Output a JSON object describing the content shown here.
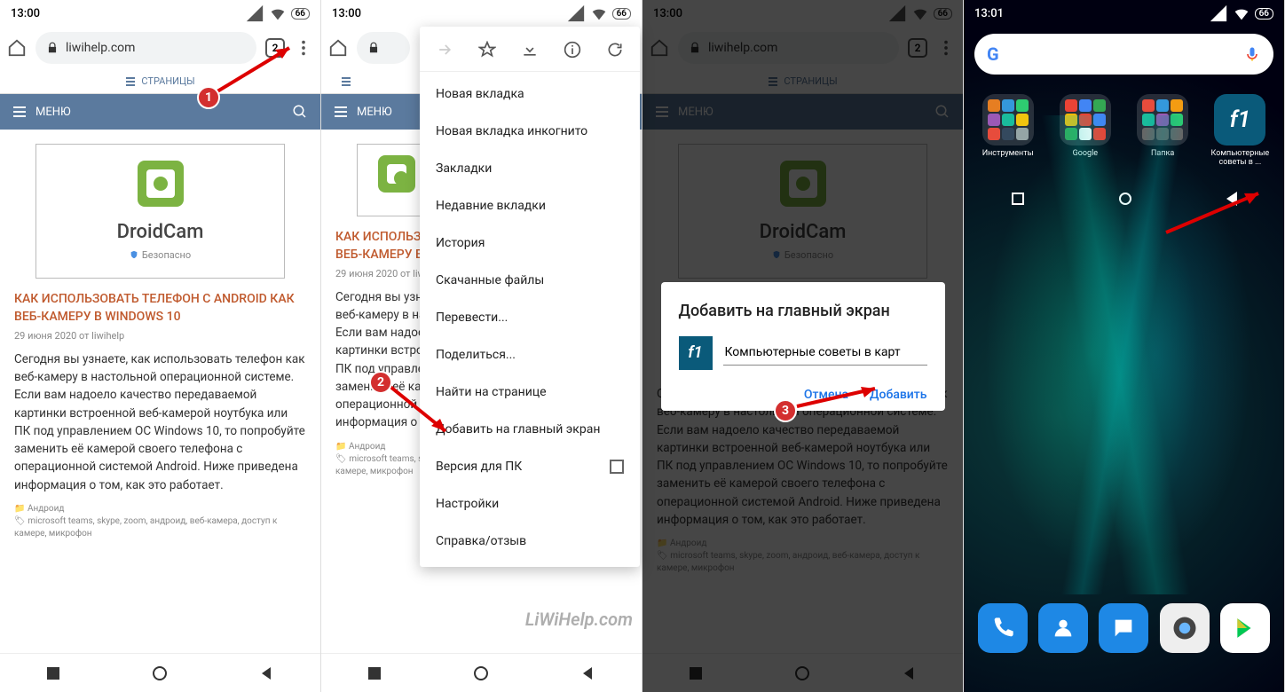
{
  "status": {
    "time1": "13:00",
    "time4": "13:01",
    "battery": "66"
  },
  "url": "liwihelp.com",
  "tabcount": "2",
  "pagesLabel": "СТРАНИЦЫ",
  "menuLabel": "МЕНЮ",
  "article": {
    "droidName": "DroidCam",
    "safe": "Безопасно",
    "title": "КАК ИСПОЛЬЗОВАТЬ ТЕЛЕФОН С ANDROID КАК ВЕБ-КАМЕРУ В WINDOWS 10",
    "titleShort": "КАК ИСПОЛЬЗОВ\nВЕБ-КАМЕРУ В",
    "meta": "29 июня 2020 от liwihelp",
    "text": "Сегодня вы узнаете, как использовать телефон как веб-камеру в настольной операционной системе. Если вам надоело качество передаваемой картинки встроенной веб-камерой ноутбука или ПК под управлением ОС Windows 10, то попробуйте заменить её камерой своего телефона с операционной системой Android. Ниже приведена информация о том, как это работает.",
    "cat": "Андроид",
    "tags": "microsoft teams, skype, zoom, андроид, веб-камера, доступ к камере, микрофон"
  },
  "menu": {
    "newTab": "Новая вкладка",
    "incognito": "Новая вкладка инкогнито",
    "bookmarks": "Закладки",
    "recent": "Недавние вкладки",
    "history": "История",
    "downloads": "Скачанные файлы",
    "translate": "Перевести...",
    "share": "Поделиться...",
    "find": "Найти на странице",
    "addHome": "Добавить на главный экран",
    "desktop": "Версия для ПК",
    "settings": "Настройки",
    "help": "Справка/отзыв"
  },
  "dialog": {
    "title": "Добавить на главный экран",
    "input": "Компьютерные советы в карт",
    "cancel": "Отмена",
    "add": "Добавить"
  },
  "home": {
    "folders": [
      "Инструменты",
      "Google",
      "Папка"
    ],
    "shortcut": "Компьютерные советы в ..."
  },
  "watermark": "LiWiHelp.com",
  "badges": {
    "b1": "1",
    "b2": "2",
    "b3": "3"
  }
}
